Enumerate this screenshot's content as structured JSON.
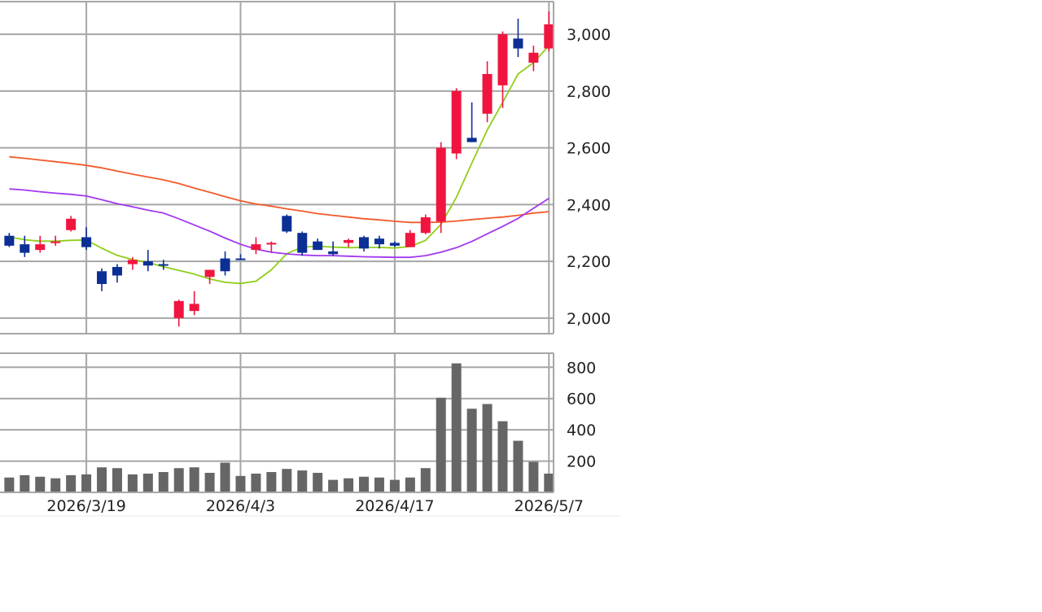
{
  "colors": {
    "up": "#f0153f",
    "down": "#0c2f95",
    "ma_short": "#8fce1a",
    "ma_mid": "#f25a2b",
    "ma_long": "#a238f0",
    "volume": "#666666",
    "grid": "#a6a6a6",
    "text": "#222222"
  },
  "chart_data": [
    {
      "type": "candlestick",
      "title": "",
      "ylim": [
        1945,
        3115
      ],
      "yticks": [
        2000,
        2200,
        2400,
        2600,
        2800,
        3000
      ],
      "ytick_labels": [
        "2,000",
        "2,200",
        "2,400",
        "2,600",
        "2,800",
        "3,000"
      ],
      "grid": true,
      "x_index_range": [
        -0.6,
        35.3
      ],
      "vertical_gridlines_at_index": [
        5,
        15,
        25,
        35
      ],
      "candles": [
        {
          "o": 2290,
          "h": 2300,
          "l": 2250,
          "c": 2255
        },
        {
          "o": 2260,
          "h": 2290,
          "l": 2215,
          "c": 2230
        },
        {
          "o": 2240,
          "h": 2290,
          "l": 2230,
          "c": 2260
        },
        {
          "o": 2265,
          "h": 2290,
          "l": 2255,
          "c": 2270
        },
        {
          "o": 2310,
          "h": 2360,
          "l": 2305,
          "c": 2350
        },
        {
          "o": 2285,
          "h": 2320,
          "l": 2240,
          "c": 2250
        },
        {
          "o": 2165,
          "h": 2175,
          "l": 2095,
          "c": 2120
        },
        {
          "o": 2180,
          "h": 2190,
          "l": 2125,
          "c": 2150
        },
        {
          "o": 2190,
          "h": 2215,
          "l": 2170,
          "c": 2205
        },
        {
          "o": 2200,
          "h": 2240,
          "l": 2165,
          "c": 2185
        },
        {
          "o": 2190,
          "h": 2205,
          "l": 2170,
          "c": 2185
        },
        {
          "o": 2000,
          "h": 2065,
          "l": 1970,
          "c": 2060
        },
        {
          "o": 2025,
          "h": 2095,
          "l": 2010,
          "c": 2050
        },
        {
          "o": 2145,
          "h": 2170,
          "l": 2120,
          "c": 2170
        },
        {
          "o": 2210,
          "h": 2235,
          "l": 2150,
          "c": 2165
        },
        {
          "o": 2210,
          "h": 2225,
          "l": 2205,
          "c": 2205
        },
        {
          "o": 2240,
          "h": 2285,
          "l": 2225,
          "c": 2260
        },
        {
          "o": 2260,
          "h": 2270,
          "l": 2230,
          "c": 2265
        },
        {
          "o": 2360,
          "h": 2365,
          "l": 2300,
          "c": 2305
        },
        {
          "o": 2300,
          "h": 2305,
          "l": 2220,
          "c": 2230
        },
        {
          "o": 2270,
          "h": 2280,
          "l": 2240,
          "c": 2240
        },
        {
          "o": 2235,
          "h": 2270,
          "l": 2220,
          "c": 2225
        },
        {
          "o": 2265,
          "h": 2280,
          "l": 2250,
          "c": 2275
        },
        {
          "o": 2285,
          "h": 2290,
          "l": 2235,
          "c": 2245
        },
        {
          "o": 2280,
          "h": 2290,
          "l": 2245,
          "c": 2260
        },
        {
          "o": 2265,
          "h": 2270,
          "l": 2250,
          "c": 2255
        },
        {
          "o": 2250,
          "h": 2310,
          "l": 2250,
          "c": 2300
        },
        {
          "o": 2300,
          "h": 2365,
          "l": 2295,
          "c": 2355
        },
        {
          "o": 2340,
          "h": 2620,
          "l": 2300,
          "c": 2600
        },
        {
          "o": 2580,
          "h": 2810,
          "l": 2560,
          "c": 2800
        },
        {
          "o": 2635,
          "h": 2760,
          "l": 2620,
          "c": 2620
        },
        {
          "o": 2720,
          "h": 2905,
          "l": 2690,
          "c": 2860
        },
        {
          "o": 2820,
          "h": 3010,
          "l": 2740,
          "c": 3000
        },
        {
          "o": 2985,
          "h": 3055,
          "l": 2920,
          "c": 2950
        },
        {
          "o": 2900,
          "h": 2960,
          "l": 2870,
          "c": 2935
        },
        {
          "o": 2950,
          "h": 3080,
          "l": 2940,
          "c": 3035
        }
      ],
      "moving_averages": [
        {
          "color_key": "ma_short",
          "values": [
            2286,
            2276,
            2271,
            2271,
            2274,
            2275,
            2246,
            2221,
            2206,
            2196,
            2181,
            2168,
            2155,
            2138,
            2126,
            2122,
            2130,
            2170,
            2227,
            2250,
            2253,
            2250,
            2248,
            2249,
            2249,
            2247,
            2252,
            2274,
            2330,
            2426,
            2546,
            2663,
            2760,
            2860,
            2900,
            2960
          ]
        },
        {
          "color_key": "ma_mid",
          "values": [
            2568,
            2563,
            2557,
            2551,
            2545,
            2538,
            2529,
            2518,
            2507,
            2497,
            2487,
            2474,
            2458,
            2443,
            2428,
            2413,
            2402,
            2394,
            2385,
            2377,
            2368,
            2362,
            2356,
            2350,
            2346,
            2341,
            2337,
            2337,
            2338,
            2342,
            2347,
            2352,
            2356,
            2362,
            2370,
            2375
          ]
        },
        {
          "color_key": "ma_long",
          "values": [
            2455,
            2451,
            2445,
            2440,
            2436,
            2430,
            2417,
            2403,
            2392,
            2380,
            2370,
            2350,
            2328,
            2306,
            2282,
            2260,
            2243,
            2232,
            2226,
            2222,
            2220,
            2220,
            2218,
            2216,
            2215,
            2214,
            2214,
            2220,
            2232,
            2248,
            2270,
            2297,
            2323,
            2351,
            2387,
            2422
          ]
        }
      ]
    },
    {
      "type": "bar",
      "title": "",
      "ylim": [
        0,
        890
      ],
      "yticks": [
        200,
        400,
        600,
        800
      ],
      "ytick_labels": [
        "200",
        "400",
        "600",
        "800"
      ],
      "grid": true,
      "values": [
        95,
        110,
        100,
        90,
        110,
        115,
        160,
        155,
        115,
        120,
        130,
        155,
        160,
        125,
        190,
        105,
        120,
        130,
        150,
        140,
        125,
        80,
        90,
        100,
        95,
        80,
        95,
        155,
        605,
        825,
        535,
        565,
        455,
        330,
        195,
        120
      ],
      "x_tick_labels": [
        {
          "index": 5,
          "label": "2026/3/19"
        },
        {
          "index": 15,
          "label": "2026/4/3"
        },
        {
          "index": 25,
          "label": "2026/4/17"
        },
        {
          "index": 35,
          "label": "2026/5/7"
        }
      ]
    }
  ]
}
